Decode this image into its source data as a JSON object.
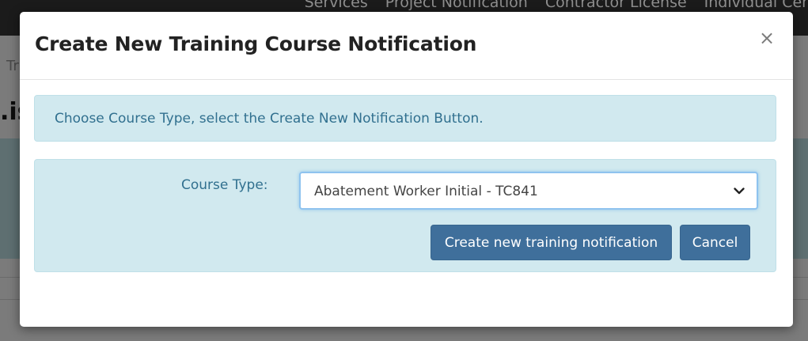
{
  "background": {
    "nav_links": [
      "Services",
      "Project Notification",
      "Contractor License",
      "Individual Cer"
    ],
    "breadcrumb": "Tr",
    "page_title": ".is"
  },
  "modal": {
    "title": "Create New Training Course Notification",
    "close_glyph": "×",
    "info_text": "Choose Course Type, select the Create New Notification Button.",
    "course_type": {
      "label": "Course Type:",
      "selected": "Abatement Worker Initial - TC841"
    },
    "buttons": {
      "create_label": "Create new training notification",
      "cancel_label": "Cancel"
    }
  },
  "colors": {
    "primary_button": "#3f6f9b",
    "info_background": "#d1e9ef",
    "info_text": "#31708f"
  },
  "icons": {
    "close": "close-icon",
    "dropdown": "chevron-down-icon"
  }
}
